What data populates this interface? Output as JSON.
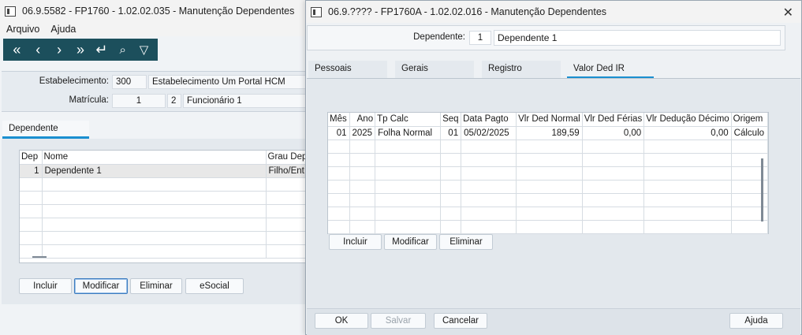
{
  "win1": {
    "title": "06.9.5582 - FP1760 - 1.02.02.035 - Manutenção Dependentes",
    "menu": [
      "Arquivo",
      "Ajuda"
    ],
    "toolbar_icons": [
      "first-icon",
      "prev-icon",
      "next-icon",
      "last-icon",
      "return-icon",
      "search-icon",
      "filter-icon"
    ],
    "estab_label": "Estabelecimento:",
    "estab_code": "300",
    "estab_name": "Estabelecimento Um Portal HCM",
    "matricula_label": "Matrícula:",
    "matricula_num": "1",
    "matricula_seq": "2",
    "matricula_name": "Funcionário 1",
    "tab": "Dependente",
    "grid_headers": [
      "Dep",
      "Nome",
      "Grau Depe"
    ],
    "grid_rows": [
      [
        "1",
        "Dependente 1",
        "Filho/Ent"
      ]
    ],
    "buttons": {
      "incluir": "Incluir",
      "modificar": "Modificar",
      "eliminar": "Eliminar",
      "esocial": "eSocial"
    }
  },
  "win2": {
    "title": "06.9.???? - FP1760A - 1.02.02.016 - Manutenção Dependentes",
    "dep_label": "Dependente:",
    "dep_num": "1",
    "dep_name": "Dependente 1",
    "tabs": [
      "Pessoais",
      "Gerais",
      "Registro",
      "Valor Ded IR"
    ],
    "active_tab": "Valor Ded IR",
    "grid_headers": [
      "Mês",
      "Ano",
      "Tp Calc",
      "Seq",
      "Data Pagto",
      "Vlr Ded Normal",
      "Vlr Ded Férias",
      "Vlr Dedução Décimo",
      "Origem"
    ],
    "grid_rows": [
      [
        "01",
        "2025",
        "Folha Normal",
        "01",
        "05/02/2025",
        "189,59",
        "0,00",
        "0,00",
        "Cálculo"
      ]
    ],
    "buttons": {
      "incluir": "Incluir",
      "modificar": "Modificar",
      "eliminar": "Eliminar"
    },
    "footer": {
      "ok": "OK",
      "salvar": "Salvar",
      "cancelar": "Cancelar",
      "ajuda": "Ajuda"
    }
  },
  "colors": {
    "toolbar": "#1c4f5c",
    "tab_accent": "#1a8fd0"
  }
}
